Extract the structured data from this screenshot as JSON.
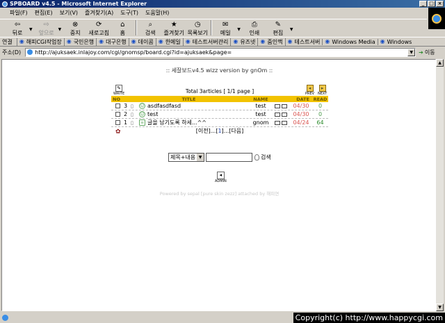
{
  "window": {
    "title": "SPBOARD v4.5 - Microsoft Internet Explorer"
  },
  "menu": [
    "파일(F)",
    "편집(E)",
    "보기(V)",
    "즐겨찾기(A)",
    "도구(T)",
    "도움말(H)"
  ],
  "toolbar": {
    "back": "뒤로",
    "forward": "앞으로",
    "stop": "중지",
    "refresh": "새로고침",
    "home": "홈",
    "search": "검색",
    "favorites": "즐겨찾기",
    "history": "목록보기",
    "mail": "메일",
    "print": "인쇄",
    "edit": "편집"
  },
  "links": {
    "label": "연결",
    "items": [
      "해피CGI작업장",
      "국민은행",
      "대구은행",
      "데이콤",
      "한메일",
      "테스트서버관리",
      "유즈넷",
      "줌인맥",
      "테스트서버",
      "Windows Media",
      "Windows"
    ]
  },
  "address": {
    "label": "주소(D)",
    "url": "http://ajuksaek.inlajoy.com/cgi/gnomsp/board.cgi?id=ajuksaek&page=",
    "go": "이동"
  },
  "board": {
    "header": ":: 세잘보드v4.5 wizz version by gnOm ::",
    "write_label": "WRITE",
    "total": "Total 3articles [ 1/1 page ]",
    "prev_label": "PREV",
    "next_label": "NEXT",
    "columns": {
      "no": "NO",
      "title": "TITLE",
      "name": "NAME",
      "date": "DATE",
      "read": "READ"
    },
    "rows": [
      {
        "no": "3",
        "title": "asdfasdfasd",
        "name": "test",
        "date": "04/30",
        "read": "0"
      },
      {
        "no": "2",
        "title": "test",
        "name": "test",
        "date": "04/30",
        "read": "0"
      },
      {
        "no": "1",
        "title": "글을 남기도록 하세...^^",
        "name": "gnom",
        "date": "04/24",
        "read": "64"
      }
    ],
    "pager": {
      "prev": "[이전]",
      "sep1": "...[",
      "current": "1",
      "sep2": "]...",
      "next": "[다음]"
    },
    "search": {
      "option": "제목+내용",
      "button": "검색"
    },
    "admin_label": "ADMIN",
    "powered": "Powered by sepal [pure skin zezz] attached by 해피연"
  },
  "copyright": "Copyright(c) http://www.happycgi.com"
}
